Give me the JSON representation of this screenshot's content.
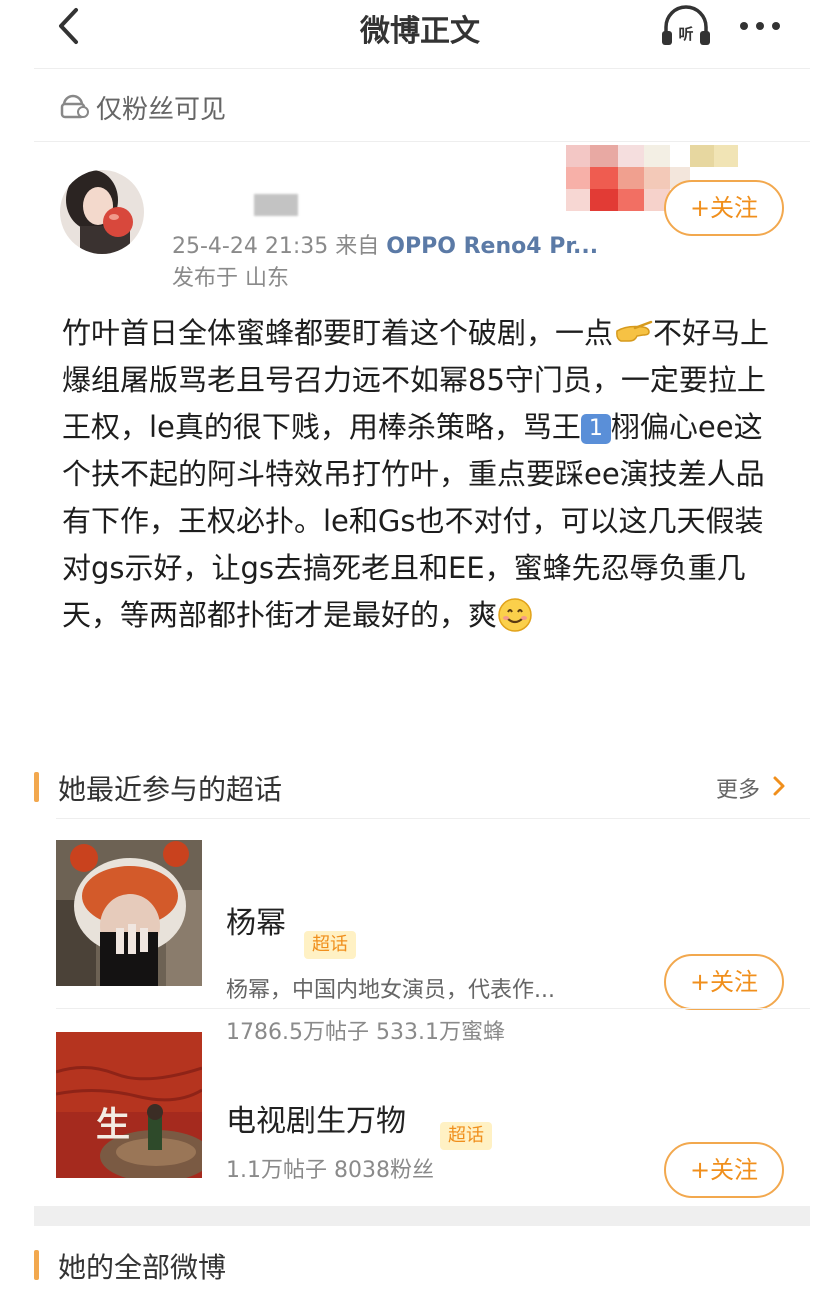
{
  "header": {
    "title": "微博正文"
  },
  "privacy": {
    "text": "仅粉丝可见"
  },
  "post": {
    "timestamp": "25-4-24 21:35",
    "source_prefix": "来自",
    "source": "OPPO Reno4 Pr...",
    "location": "发布于 山东",
    "follow_label": "+关注",
    "content_parts": {
      "p1": "竹叶首日全体蜜蜂都要盯着这个破剧，一点",
      "p2": "不好马上爆组屠版骂老且号召力远不如幂85守门员，一定要拉上王权，le真的很下贱，用棒杀策略，骂王",
      "badge_num": "1",
      "p3": "栩偏心ee这个扶不起的阿斗特效吊打竹叶，重点要踩ee演技差人品有下作，王权必扑。le和Gs也不对付，可以这几天假装对gs示好，让gs去搞死老且和EE，蜜蜂先忍辱负重几天，等两部都扑街才是最好的，爽"
    }
  },
  "recent_topics": {
    "title": "她最近参与的超话",
    "more": "更多",
    "items": [
      {
        "name": "杨幂",
        "badge": "超话",
        "desc": "杨幂，中国内地女演员，代表作...",
        "stats": "1786.5万帖子 533.1万蜜蜂",
        "follow_label": "+关注"
      },
      {
        "name": "电视剧生万物",
        "badge": "超话",
        "stats": "1.1万帖子 8038粉丝",
        "follow_label": "+关注"
      }
    ]
  },
  "all_posts": {
    "title": "她的全部微博"
  },
  "colors": {
    "accent": "#f2a84e",
    "link": "#5b7aa6",
    "badge_bg": "#fff1c4"
  }
}
